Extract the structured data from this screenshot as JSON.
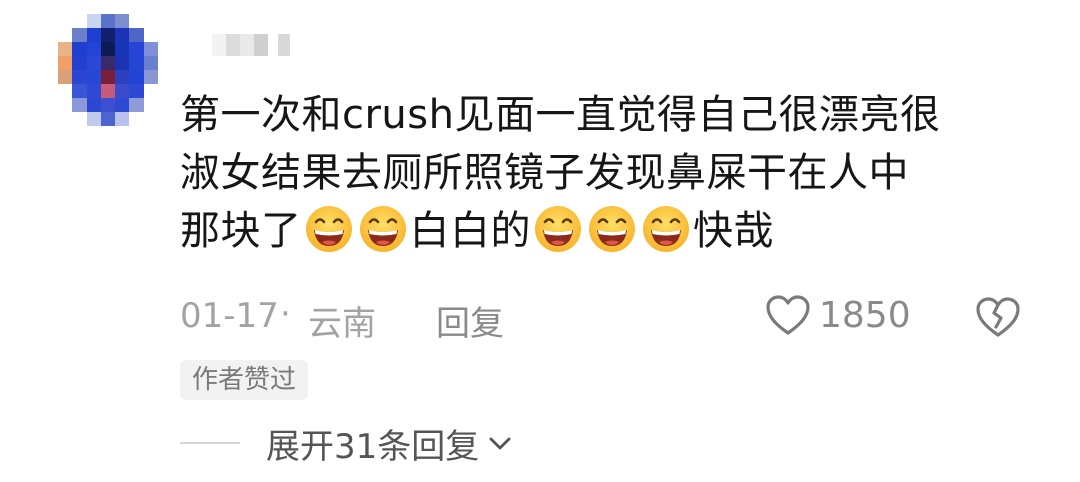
{
  "comment": {
    "text_line1": "第一次和crush见面一直觉得自己很漂亮很",
    "text_line2": "淑女结果去厕所照镜子发现鼻屎干在人中",
    "text_line3_a": "那块了",
    "text_line3_b": "白白的",
    "text_line3_c": "快哉",
    "emoji_name": "grinning-face-emoji",
    "date": "01-17",
    "dot": "·",
    "location": "云南",
    "reply_label": "回复",
    "like_count": "1850",
    "author_badge": "作者赞过",
    "expand_label": "展开31条回复"
  },
  "colors": {
    "text_primary": "#161616",
    "text_meta": "#a3a3a3",
    "badge_bg": "#f2f2f2",
    "emoji_yellow": "#ffc83d",
    "avatar_blue": "#1f3fd0"
  },
  "icons": {
    "like": "heart-outline-icon",
    "dislike": "broken-heart-outline-icon",
    "expand": "chevron-down-icon"
  }
}
